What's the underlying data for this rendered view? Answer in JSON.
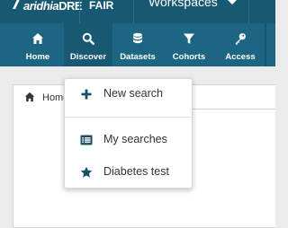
{
  "topbar": {
    "logo_prefix": "aridhia",
    "logo_suffix": "DRE",
    "fair_label": "FAIR",
    "workspaces_label": "Workspaces"
  },
  "nav": {
    "items": [
      {
        "label": "Home",
        "icon": "home-icon"
      },
      {
        "label": "Discover",
        "icon": "search-icon",
        "active": true
      },
      {
        "label": "Datasets",
        "icon": "database-icon"
      },
      {
        "label": "Cohorts",
        "icon": "filter-icon"
      },
      {
        "label": "Access",
        "icon": "key-icon"
      }
    ]
  },
  "tab": {
    "label": "Home"
  },
  "dropdown": {
    "items": [
      {
        "label": "New search",
        "icon": "plus-icon"
      },
      {
        "label": "My searches",
        "icon": "list-icon"
      },
      {
        "label": "Diabetes test",
        "icon": "star-icon"
      }
    ]
  },
  "colors": {
    "topbar": "#175872",
    "navbar": "#1c6683",
    "icon_accent": "#1c4f66"
  }
}
